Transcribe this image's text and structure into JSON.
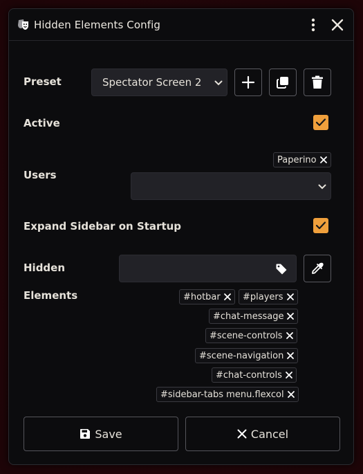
{
  "window": {
    "title": "Hidden Elements Config",
    "title_icon": "theater-mask-icon",
    "menu_icon": "kebab-menu-icon",
    "close_icon": "close-icon"
  },
  "preset": {
    "label": "Preset",
    "selected": "Spectator Screen 2",
    "add_icon": "plus-icon",
    "duplicate_icon": "copy-icon",
    "delete_icon": "trash-icon"
  },
  "active": {
    "label": "Active",
    "checked": true
  },
  "users": {
    "label": "Users",
    "tags": [
      "Paperino"
    ],
    "select_value": ""
  },
  "expand_sidebar": {
    "label": "Expand Sidebar on Startup",
    "checked": true
  },
  "hidden": {
    "label_line1": "Hidden",
    "label_line2": "Elements",
    "input_value": "",
    "tag_icon": "tag-icon",
    "picker_icon": "eyedropper-icon",
    "tags": [
      "#hotbar",
      "#players",
      "#chat-message",
      "#scene-controls",
      "#scene-navigation",
      "#chat-controls",
      "#sidebar-tabs menu.flexcol"
    ]
  },
  "footer": {
    "save_label": "Save",
    "cancel_label": "Cancel"
  },
  "colors": {
    "accent": "#f0a03c",
    "window_bg": "#0c0c0e",
    "field_bg": "#222227"
  }
}
